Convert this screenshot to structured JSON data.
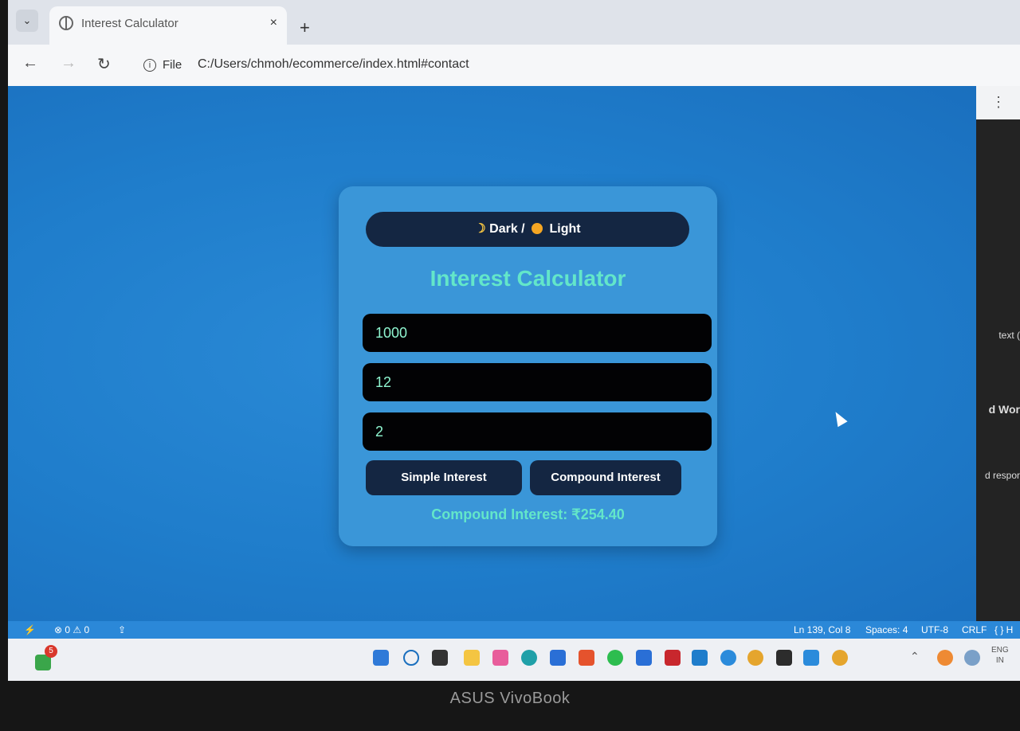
{
  "browser": {
    "tab_title": "Interest Calculator",
    "tab_close": "×",
    "new_tab": "+",
    "file_label": "File",
    "url": "C:/Users/chmoh/ecommerce/index.html#contact",
    "window_controls": [
      "—",
      "☐",
      "✕"
    ]
  },
  "app": {
    "theme_toggle": {
      "dark": "Dark /",
      "light": "Light"
    },
    "title": "Interest Calculator",
    "inputs": [
      {
        "value": "1000"
      },
      {
        "value": "12"
      },
      {
        "value": "2"
      }
    ],
    "buttons": {
      "simple": "Simple Interest",
      "compound": "Compound Interest"
    },
    "result": "Compound Interest: ₹254.40"
  },
  "side_panel": {
    "snippets": [
      "text (",
      "d Wor",
      "d respor"
    ]
  },
  "statusbar": {
    "problems": "⊗ 0 ⚠ 0",
    "cursor_pos": "Ln 139, Col 8",
    "spaces": "Spaces: 4",
    "encoding": "UTF-8",
    "eol": "CRLF",
    "lang": "{ } H"
  },
  "taskbar": {
    "notification_count": "5",
    "tray_lang_1": "ENG",
    "tray_lang_2": "IN"
  },
  "brand": "ASUS VivoBook",
  "colors": {
    "page_bg": "#1f7dcb",
    "card_bg": "#3a96d8",
    "accent_teal": "#63e6c9",
    "button_navy": "#142642"
  }
}
